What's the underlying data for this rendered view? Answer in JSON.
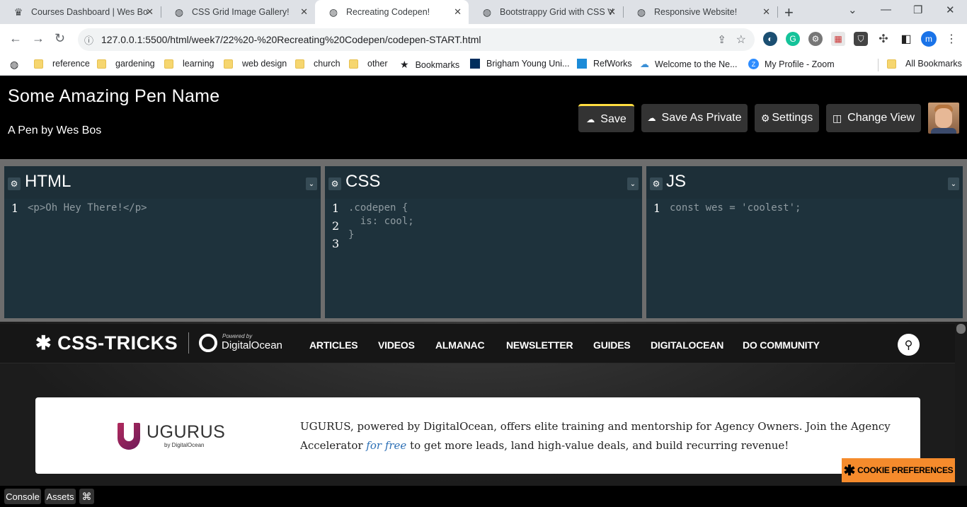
{
  "browser": {
    "tabs": [
      {
        "title": "Courses Dashboard | Wes Bo",
        "icon": "crown-icon"
      },
      {
        "title": "CSS Grid Image Gallery!",
        "icon": "globe-icon"
      },
      {
        "title": "Recreating Codepen!",
        "icon": "globe-icon",
        "active": true
      },
      {
        "title": "Bootstrappy Grid with CSS V",
        "icon": "globe-icon"
      },
      {
        "title": "Responsive Website!",
        "icon": "globe-icon"
      }
    ],
    "url": "127.0.0.1:5500/html/week7/22%20-%20Recreating%20Codepen/codepen-START.html",
    "profile_initial": "m",
    "bookmarks": [
      {
        "label": "reference"
      },
      {
        "label": "gardening"
      },
      {
        "label": "learning"
      },
      {
        "label": "web design"
      },
      {
        "label": "church"
      },
      {
        "label": "other"
      },
      {
        "label": "Bookmarks"
      },
      {
        "label": "Brigham Young Uni..."
      },
      {
        "label": "RefWorks"
      },
      {
        "label": "Welcome to the Ne..."
      },
      {
        "label": "My Profile - Zoom"
      },
      {
        "label": "All Bookmarks"
      }
    ]
  },
  "pen": {
    "title": "Some Amazing Pen Name",
    "author": "A Pen by Wes Bos",
    "buttons": {
      "save": "Save",
      "save_private": "Save As Private",
      "settings": "Settings",
      "change_view": "Change View"
    }
  },
  "editors": [
    {
      "title": "HTML",
      "lines": [
        "1"
      ],
      "code": [
        "<p>Oh Hey There!</p>"
      ]
    },
    {
      "title": "CSS",
      "lines": [
        "1",
        "2",
        "3"
      ],
      "code": [
        ".codepen {",
        "  is: cool;",
        "}"
      ]
    },
    {
      "title": "JS",
      "lines": [
        "1"
      ],
      "code": [
        "const wes = 'coolest';"
      ]
    }
  ],
  "preview": {
    "logo": "CSS-TRICKS",
    "powered_by": "Powered by",
    "sponsor": "DigitalOcean",
    "nav": [
      "ARTICLES",
      "VIDEOS",
      "ALMANAC",
      "NEWSLETTER",
      "GUIDES",
      "DIGITALOCEAN",
      "DO COMMUNITY"
    ],
    "ad": {
      "brand": "UGURUS",
      "brand_by": "by DigitalOcean",
      "text_before": "UGURUS, powered by DigitalOcean, offers elite training and mentorship for Agency Owners. Join the Agency Accelerator ",
      "link_text": "for free",
      "text_after": " to get more leads, land high-value deals, and build recurring revenue!"
    },
    "cookie_button": "COOKIE PREFERENCES"
  },
  "footer": {
    "console": "Console",
    "assets": "Assets",
    "shortcut": "⌘"
  }
}
